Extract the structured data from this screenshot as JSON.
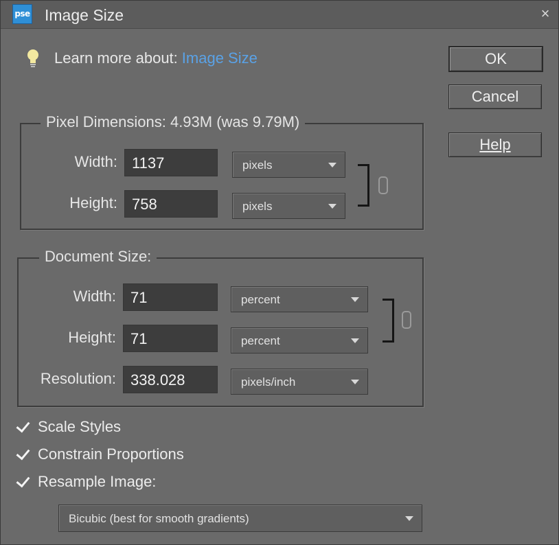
{
  "window": {
    "app_icon_text": "pse",
    "title": "Image Size",
    "close_glyph": "×"
  },
  "learn": {
    "prefix": "Learn more about:",
    "link": "Image Size",
    "icon": "lightbulb-icon"
  },
  "buttons": {
    "ok": "OK",
    "cancel": "Cancel",
    "help": "Help"
  },
  "pixel_dimensions": {
    "legend": "Pixel Dimensions:  4.93M (was 9.79M)",
    "width_label": "Width:",
    "width_value": "1137",
    "width_unit": "pixels",
    "height_label": "Height:",
    "height_value": "758",
    "height_unit": "pixels"
  },
  "document_size": {
    "legend": "Document Size:",
    "width_label": "Width:",
    "width_value": "71",
    "width_unit": "percent",
    "height_label": "Height:",
    "height_value": "71",
    "height_unit": "percent",
    "resolution_label": "Resolution:",
    "resolution_value": "338.028",
    "resolution_unit": "pixels/inch"
  },
  "options": {
    "scale_styles": {
      "label": "Scale Styles",
      "checked": true
    },
    "constrain_proportions": {
      "label": "Constrain Proportions",
      "checked": true
    },
    "resample_image": {
      "label": "Resample Image:",
      "checked": true
    }
  },
  "resample_method": "Bicubic (best for smooth gradients)",
  "colors": {
    "dialog_bg": "#6a6a6a",
    "field_bg": "#3d3d3d",
    "link": "#5aa2e6",
    "accent_icon": "#2f8fd6"
  }
}
